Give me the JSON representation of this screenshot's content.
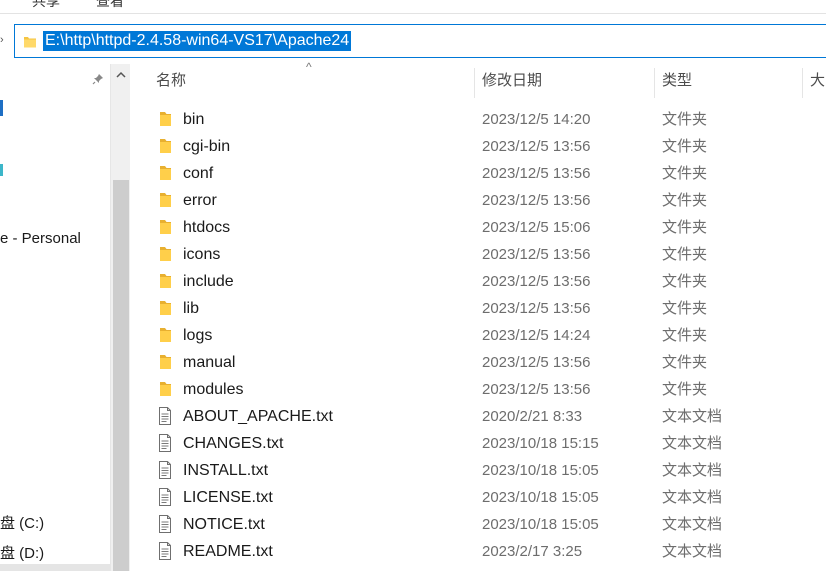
{
  "ribbon": {
    "tab_share": "共享",
    "tab_view": "查看"
  },
  "address": {
    "path": "E:\\http\\httpd-2.4.58-win64-VS17\\Apache24",
    "icon": "folder-icon"
  },
  "nav": {
    "items": [
      {
        "label": "e - Personal"
      },
      {
        "label": "盘 (C:)"
      },
      {
        "label": "盘 (D:)"
      }
    ]
  },
  "columns": {
    "name": "名称",
    "date": "修改日期",
    "type": "类型",
    "size": "大"
  },
  "files": [
    {
      "name": "bin",
      "date": "2023/12/5 14:20",
      "type": "文件夹",
      "icon": "folder-icon"
    },
    {
      "name": "cgi-bin",
      "date": "2023/12/5 13:56",
      "type": "文件夹",
      "icon": "folder-icon"
    },
    {
      "name": "conf",
      "date": "2023/12/5 13:56",
      "type": "文件夹",
      "icon": "folder-icon"
    },
    {
      "name": "error",
      "date": "2023/12/5 13:56",
      "type": "文件夹",
      "icon": "folder-icon"
    },
    {
      "name": "htdocs",
      "date": "2023/12/5 15:06",
      "type": "文件夹",
      "icon": "folder-icon"
    },
    {
      "name": "icons",
      "date": "2023/12/5 13:56",
      "type": "文件夹",
      "icon": "folder-icon"
    },
    {
      "name": "include",
      "date": "2023/12/5 13:56",
      "type": "文件夹",
      "icon": "folder-icon"
    },
    {
      "name": "lib",
      "date": "2023/12/5 13:56",
      "type": "文件夹",
      "icon": "folder-icon"
    },
    {
      "name": "logs",
      "date": "2023/12/5 14:24",
      "type": "文件夹",
      "icon": "folder-icon"
    },
    {
      "name": "manual",
      "date": "2023/12/5 13:56",
      "type": "文件夹",
      "icon": "folder-icon"
    },
    {
      "name": "modules",
      "date": "2023/12/5 13:56",
      "type": "文件夹",
      "icon": "folder-icon"
    },
    {
      "name": "ABOUT_APACHE.txt",
      "date": "2020/2/21 8:33",
      "type": "文本文档",
      "icon": "text-file-icon"
    },
    {
      "name": "CHANGES.txt",
      "date": "2023/10/18 15:15",
      "type": "文本文档",
      "icon": "text-file-icon"
    },
    {
      "name": "INSTALL.txt",
      "date": "2023/10/18 15:05",
      "type": "文本文档",
      "icon": "text-file-icon"
    },
    {
      "name": "LICENSE.txt",
      "date": "2023/10/18 15:05",
      "type": "文本文档",
      "icon": "text-file-icon"
    },
    {
      "name": "NOTICE.txt",
      "date": "2023/10/18 15:05",
      "type": "文本文档",
      "icon": "text-file-icon"
    },
    {
      "name": "README.txt",
      "date": "2023/2/17 3:25",
      "type": "文本文档",
      "icon": "text-file-icon"
    }
  ]
}
